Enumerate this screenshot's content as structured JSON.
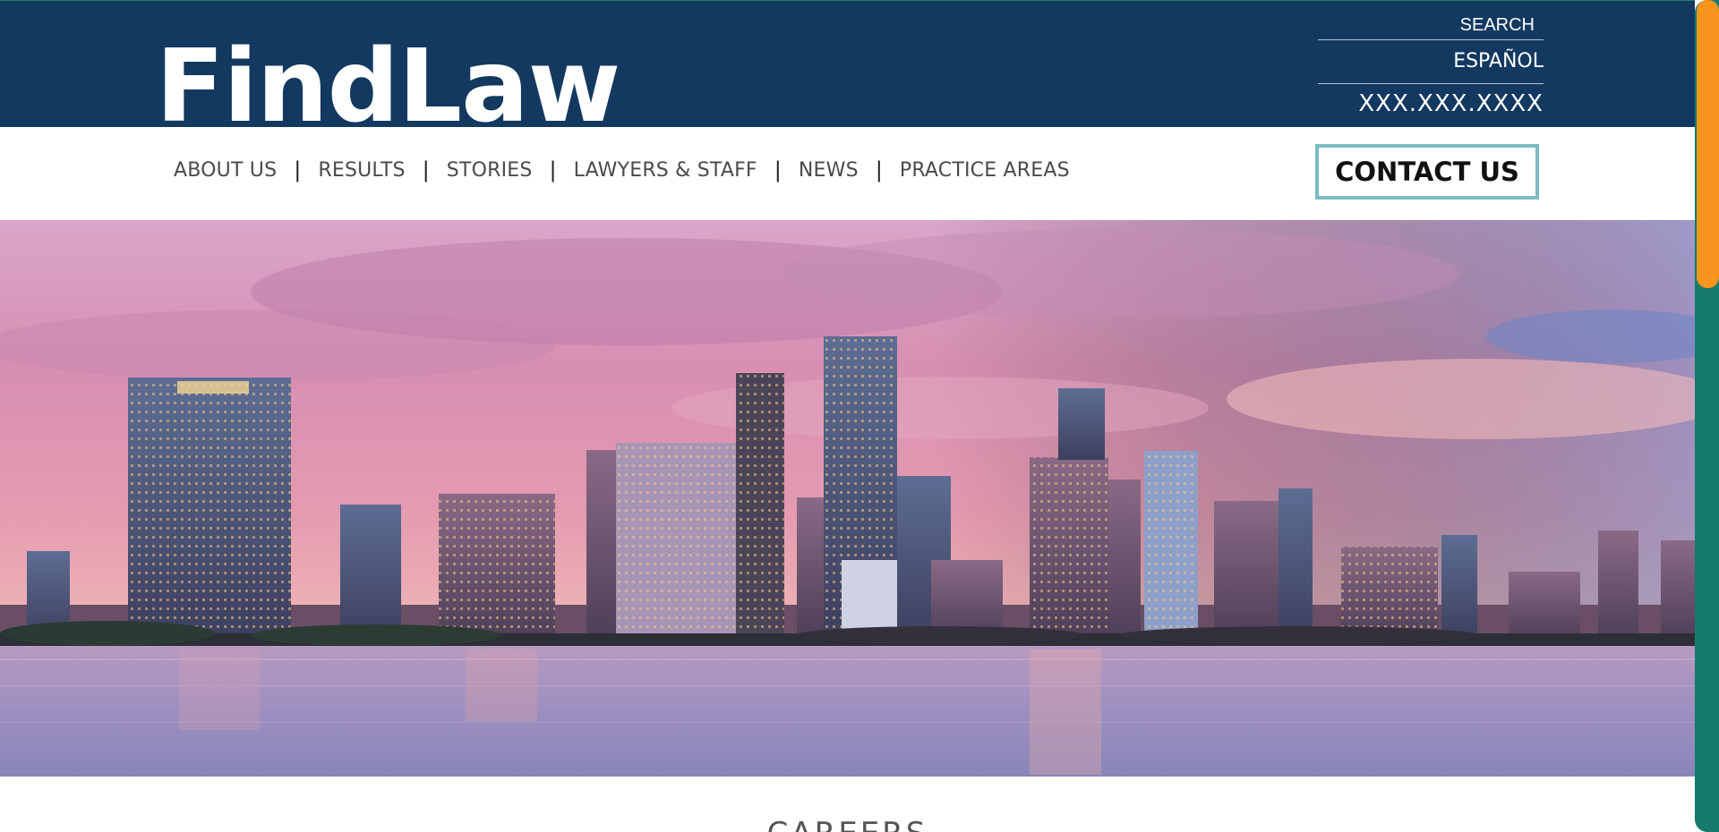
{
  "header": {
    "logo": "FindLaw",
    "search_label": "SEARCH",
    "language_label": "ESPAÑOL",
    "phone": "XXX.XXX.XXXX"
  },
  "nav": {
    "items": [
      {
        "label": "ABOUT US"
      },
      {
        "label": "RESULTS"
      },
      {
        "label": "STORIES"
      },
      {
        "label": "LAWYERS & STAFF"
      },
      {
        "label": "NEWS"
      },
      {
        "label": "PRACTICE AREAS"
      }
    ],
    "separator": "|",
    "contact_label": "CONTACT US"
  },
  "hero": {
    "subject": "city-skyline-waterfront-at-dusk"
  },
  "section": {
    "heading": "CAREERS"
  },
  "colors": {
    "header_bg": "#133960",
    "contact_border": "#7bbcc3",
    "scrollbar_track": "#157a6b",
    "scrollbar_thumb": "#f7941e"
  }
}
